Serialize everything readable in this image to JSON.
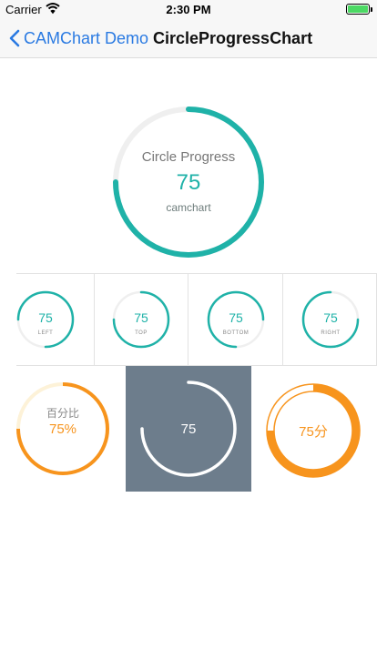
{
  "status_bar": {
    "carrier": "Carrier",
    "time": "2:30 PM",
    "battery_level": 1.0,
    "battery_color": "#4cd964"
  },
  "nav": {
    "back_label": "CAMChart Demo",
    "title": "CircleProgressChart"
  },
  "colors": {
    "teal": "#1fb2a8",
    "orange": "#f7941d",
    "track": "#efefef",
    "slate": "#6d7d8c"
  },
  "main_chart": {
    "title": "Circle Progress",
    "value": "75",
    "subtitle": "camchart",
    "progress": 0.75
  },
  "position_charts": [
    {
      "value": "75",
      "position": "LEFT",
      "progress": 0.75
    },
    {
      "value": "75",
      "position": "TOP",
      "progress": 0.75
    },
    {
      "value": "75",
      "position": "BOTTOM",
      "progress": 0.75
    },
    {
      "value": "75",
      "position": "RIGHT",
      "progress": 0.75
    }
  ],
  "style_charts": {
    "percent": {
      "title": "百分比",
      "value": "75%",
      "progress": 0.75
    },
    "dark": {
      "value": "75",
      "progress": 0.75
    },
    "score": {
      "value": "75分",
      "progress": 0.75
    }
  }
}
